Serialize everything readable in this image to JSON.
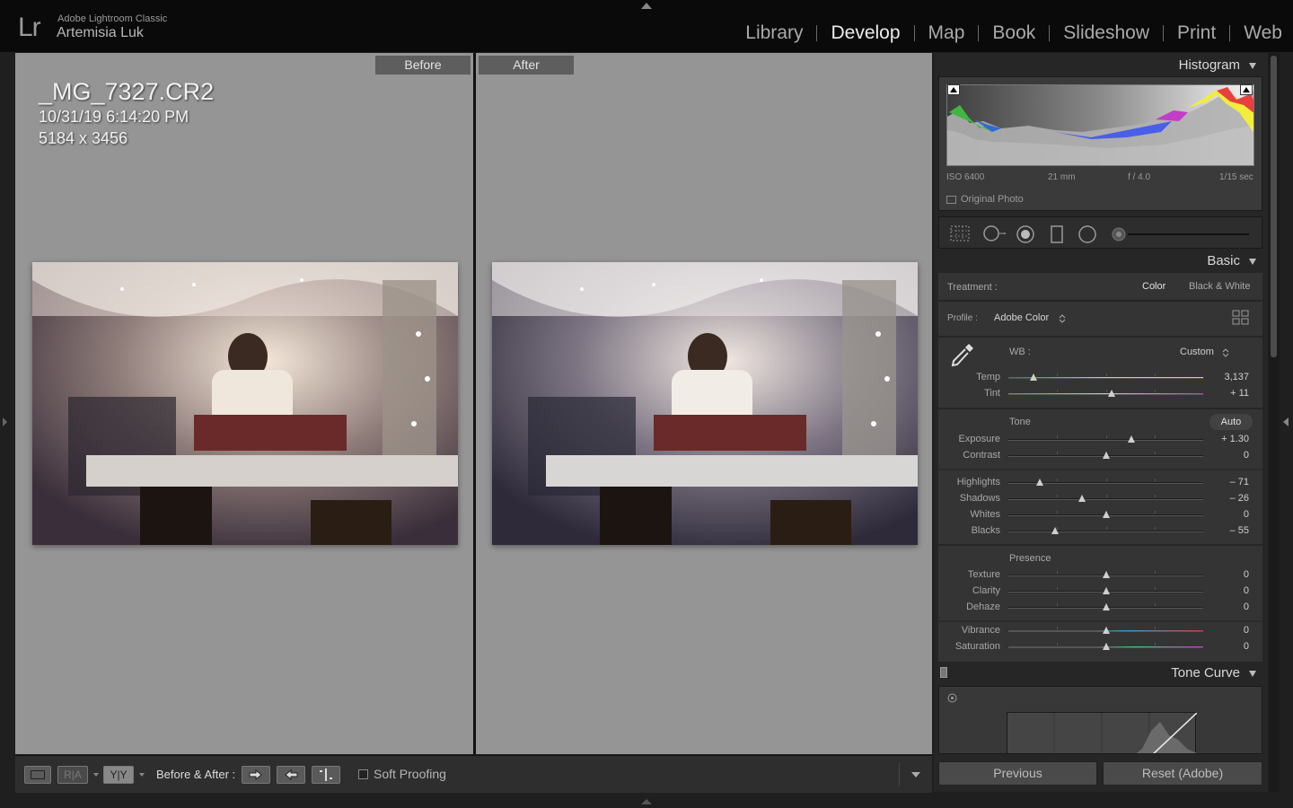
{
  "header": {
    "logo": "Lr",
    "app_name": "Adobe Lightroom Classic",
    "user_name": "Artemisia Luk",
    "modules": [
      "Library",
      "Develop",
      "Map",
      "Book",
      "Slideshow",
      "Print",
      "Web"
    ],
    "active_module": "Develop"
  },
  "view": {
    "before_label": "Before",
    "after_label": "After",
    "info": {
      "file_name": "_MG_7327.CR2",
      "capture_date": "10/31/19 6:14:20 PM",
      "dimensions": "5184 x 3456"
    }
  },
  "toolbar": {
    "ra_label": "R|A",
    "yy_label": "Y|Y",
    "before_after_label": "Before & After :",
    "soft_proofing_label": "Soft Proofing"
  },
  "histogram": {
    "title": "Histogram",
    "exif": {
      "iso": "ISO 6400",
      "focal": "21 mm",
      "aperture": "f / 4.0",
      "shutter": "1/15 sec"
    },
    "original_photo_label": "Original Photo"
  },
  "basic": {
    "title": "Basic",
    "treatment_label": "Treatment :",
    "treatment_color": "Color",
    "treatment_bw": "Black & White",
    "profile_label": "Profile :",
    "profile_value": "Adobe Color",
    "wb_label": "WB :",
    "wb_value": "Custom",
    "tone_label": "Tone",
    "auto_label": "Auto",
    "presence_label": "Presence",
    "sliders": {
      "temp": {
        "label": "Temp",
        "value": "3,137",
        "pos": 0.13
      },
      "tint": {
        "label": "Tint",
        "value": "+ 11",
        "pos": 0.53
      },
      "exposure": {
        "label": "Exposure",
        "value": "+ 1.30",
        "pos": 0.63
      },
      "contrast": {
        "label": "Contrast",
        "value": "0",
        "pos": 0.5
      },
      "highlights": {
        "label": "Highlights",
        "value": "– 71",
        "pos": 0.16
      },
      "shadows": {
        "label": "Shadows",
        "value": "– 26",
        "pos": 0.38
      },
      "whites": {
        "label": "Whites",
        "value": "0",
        "pos": 0.5
      },
      "blacks": {
        "label": "Blacks",
        "value": "– 55",
        "pos": 0.24
      },
      "texture": {
        "label": "Texture",
        "value": "0",
        "pos": 0.5
      },
      "clarity": {
        "label": "Clarity",
        "value": "0",
        "pos": 0.5
      },
      "dehaze": {
        "label": "Dehaze",
        "value": "0",
        "pos": 0.5
      },
      "vibrance": {
        "label": "Vibrance",
        "value": "0",
        "pos": 0.5
      },
      "saturation": {
        "label": "Saturation",
        "value": "0",
        "pos": 0.5
      }
    }
  },
  "tone_curve": {
    "title": "Tone Curve"
  },
  "buttons": {
    "previous": "Previous",
    "reset": "Reset (Adobe)"
  },
  "colors": {
    "accent_active": "#ececec",
    "panel_bg": "#343434",
    "view_bg": "#959595"
  }
}
